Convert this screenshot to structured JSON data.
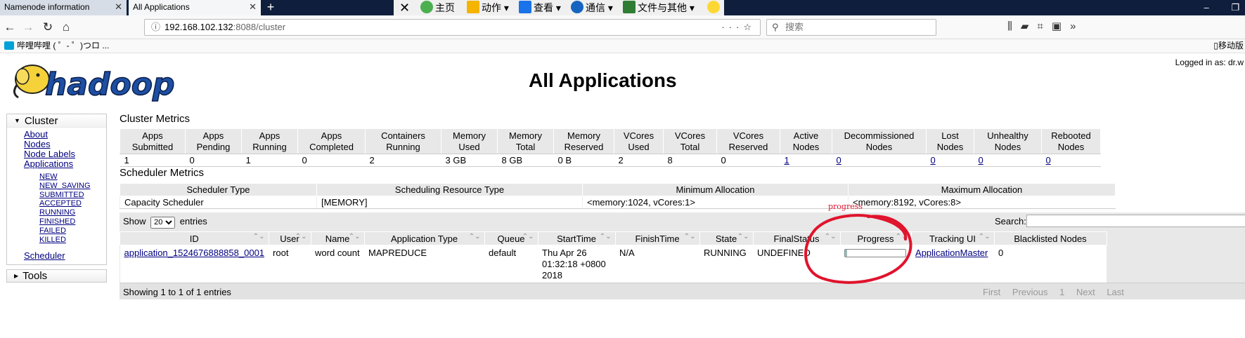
{
  "browser": {
    "tabs": [
      {
        "title": "Namenode information",
        "active": false
      },
      {
        "title": "All Applications",
        "active": true
      }
    ],
    "ext_toolbar": [
      "主页",
      "动作",
      "查看",
      "通信",
      "文件与其他"
    ],
    "url": {
      "host": "192.168.102.132",
      "path": ":8088/cluster"
    },
    "search_placeholder": "搜索",
    "bookmark": "哔哩哔哩 ( ゜- ゜)つロ ...",
    "mobile_bookmarks": "移动版"
  },
  "header": {
    "logged_in": "Logged in as: dr.w",
    "title": "All Applications",
    "logo_text": "hadoop"
  },
  "sidebar": {
    "cluster_label": "Cluster",
    "links": [
      "About",
      "Nodes",
      "Node Labels",
      "Applications"
    ],
    "app_states": [
      "NEW",
      "NEW_SAVING",
      "SUBMITTED",
      "ACCEPTED",
      "RUNNING",
      "FINISHED",
      "FAILED",
      "KILLED"
    ],
    "scheduler": "Scheduler",
    "tools_label": "Tools"
  },
  "cluster_metrics": {
    "title": "Cluster Metrics",
    "headers": [
      [
        "Apps",
        "Submitted"
      ],
      [
        "Apps",
        "Pending"
      ],
      [
        "Apps",
        "Running"
      ],
      [
        "Apps",
        "Completed"
      ],
      [
        "Containers",
        "Running"
      ],
      [
        "Memory",
        "Used"
      ],
      [
        "Memory",
        "Total"
      ],
      [
        "Memory",
        "Reserved"
      ],
      [
        "VCores",
        "Used"
      ],
      [
        "VCores",
        "Total"
      ],
      [
        "VCores",
        "Reserved"
      ],
      [
        "Active",
        "Nodes"
      ],
      [
        "Decommissioned",
        "Nodes"
      ],
      [
        "Lost",
        "Nodes"
      ],
      [
        "Unhealthy",
        "Nodes"
      ],
      [
        "Rebooted",
        "Nodes"
      ]
    ],
    "values": [
      "1",
      "0",
      "1",
      "0",
      "2",
      "3 GB",
      "8 GB",
      "0 B",
      "2",
      "8",
      "0",
      "1",
      "0",
      "0",
      "0",
      "0"
    ]
  },
  "scheduler_metrics": {
    "title": "Scheduler Metrics",
    "headers": [
      "Scheduler Type",
      "Scheduling Resource Type",
      "Minimum Allocation",
      "Maximum Allocation"
    ],
    "values": [
      "Capacity Scheduler",
      "[MEMORY]",
      "<memory:1024, vCores:1>",
      "<memory:8192, vCores:8>"
    ]
  },
  "apps_table": {
    "show_label": "Show",
    "entries_value": "20",
    "entries_label": "entries",
    "search_label": "Search:",
    "headers": [
      "ID",
      "User",
      "Name",
      "Application Type",
      "Queue",
      "StartTime",
      "FinishTime",
      "State",
      "FinalStatus",
      "Progress",
      "Tracking UI",
      "Blacklisted Nodes"
    ],
    "row": {
      "id": "application_1524676888858_0001",
      "user": "root",
      "name": "word count",
      "type": "MAPREDUCE",
      "queue": "default",
      "start": "Thu Apr 26 01:32:18 +0800 2018",
      "finish": "N/A",
      "state": "RUNNING",
      "final_status": "UNDEFINED",
      "progress": 0.03,
      "tracking_ui": "ApplicationMaster",
      "blacklisted": "0"
    },
    "footer_info": "Showing 1 to 1 of 1 entries",
    "pager": [
      "First",
      "Previous",
      "1",
      "Next",
      "Last"
    ]
  },
  "annotation": {
    "text": "progress",
    "color": "#e0142d"
  }
}
